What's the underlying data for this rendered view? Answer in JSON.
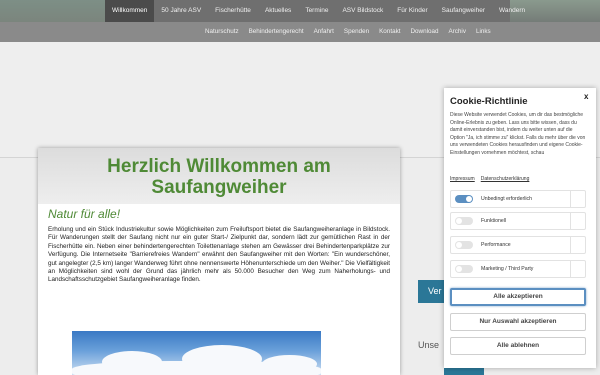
{
  "nav_primary": [
    "Willkommen",
    "50 Jahre ASV",
    "Fischerhütte",
    "Aktuelles",
    "Termine",
    "ASV Bildstock",
    "Für Kinder",
    "Saufangweiher",
    "Wandern"
  ],
  "nav_secondary": [
    "Naturschutz",
    "Behindertengerecht",
    "Anfahrt",
    "Spenden",
    "Kontakt",
    "Download",
    "Archiv",
    "Links"
  ],
  "main": {
    "heading": "Herzlich Willkommen am Saufangweiher",
    "subtitle": "Natur für alle!",
    "intro": "Erholung und ein Stück Industriekultur sowie Möglichkeiten zum Freiluftsport bietet die Saufangweiheranlage in Bildstock. Für Wanderungen stellt der Saufang nicht nur ein guter Start-/ Zielpunkt dar, sondern lädt zur gemütlichen Rast in der Fischerhütte ein. Neben einer behindertengerechten Toilettenanlage stehen am Gewässer drei Behindertenparkplätze zur Verfügung. Die Internetseite \"Barrierefreies Wandern\" erwähnt den Saufangweiher mit den Worten: \"Ein wunderschöner, gut angelegter (2,5 km) langer Wanderweg führt ohne nennenswerte Höhenunterschiede um den Weiher.\" Die Vielfältigkeit an Möglichkeiten sind wohl der Grund das jährlich mehr als 50.000 Besucher den Weg zum Naherholungs- und Landschaftsschutzgebiet Saufangweiheranlage finden."
  },
  "sidebar": {
    "button_label": "Ver",
    "text": "Unse"
  },
  "cookie": {
    "title": "Cookie-Richtlinie",
    "close": "x",
    "description": "Diese Website verwendet Cookies, um dir das bestmögliche Online-Erlebnis zu geben. Lass uns bitte wissen, dass du damit einverstanden bist, indem du weiter unten auf die Option \"Ja, ich stimme zu\" klickst. Falls du mehr über die von uns verwendeten Cookies herausfinden und eigene Cookie-Einstellungen vornehmen möchtest, schau",
    "link_imprint": "Impressum",
    "link_privacy": "Datenschutzerklärung",
    "options": [
      {
        "label": "Unbedingt erforderlich",
        "enabled": true
      },
      {
        "label": "Funktionell",
        "enabled": false
      },
      {
        "label": "Performance",
        "enabled": false
      },
      {
        "label": "Marketing / Third Party",
        "enabled": false
      }
    ],
    "accept_all": "Alle akzeptieren",
    "accept_selection": "Nur Auswahl akzeptieren",
    "reject_all": "Alle ablehnen"
  },
  "colors": {
    "accent_green": "#4f8a36",
    "button_blue": "#2b7797",
    "toggle_on": "#5b8fc1"
  }
}
